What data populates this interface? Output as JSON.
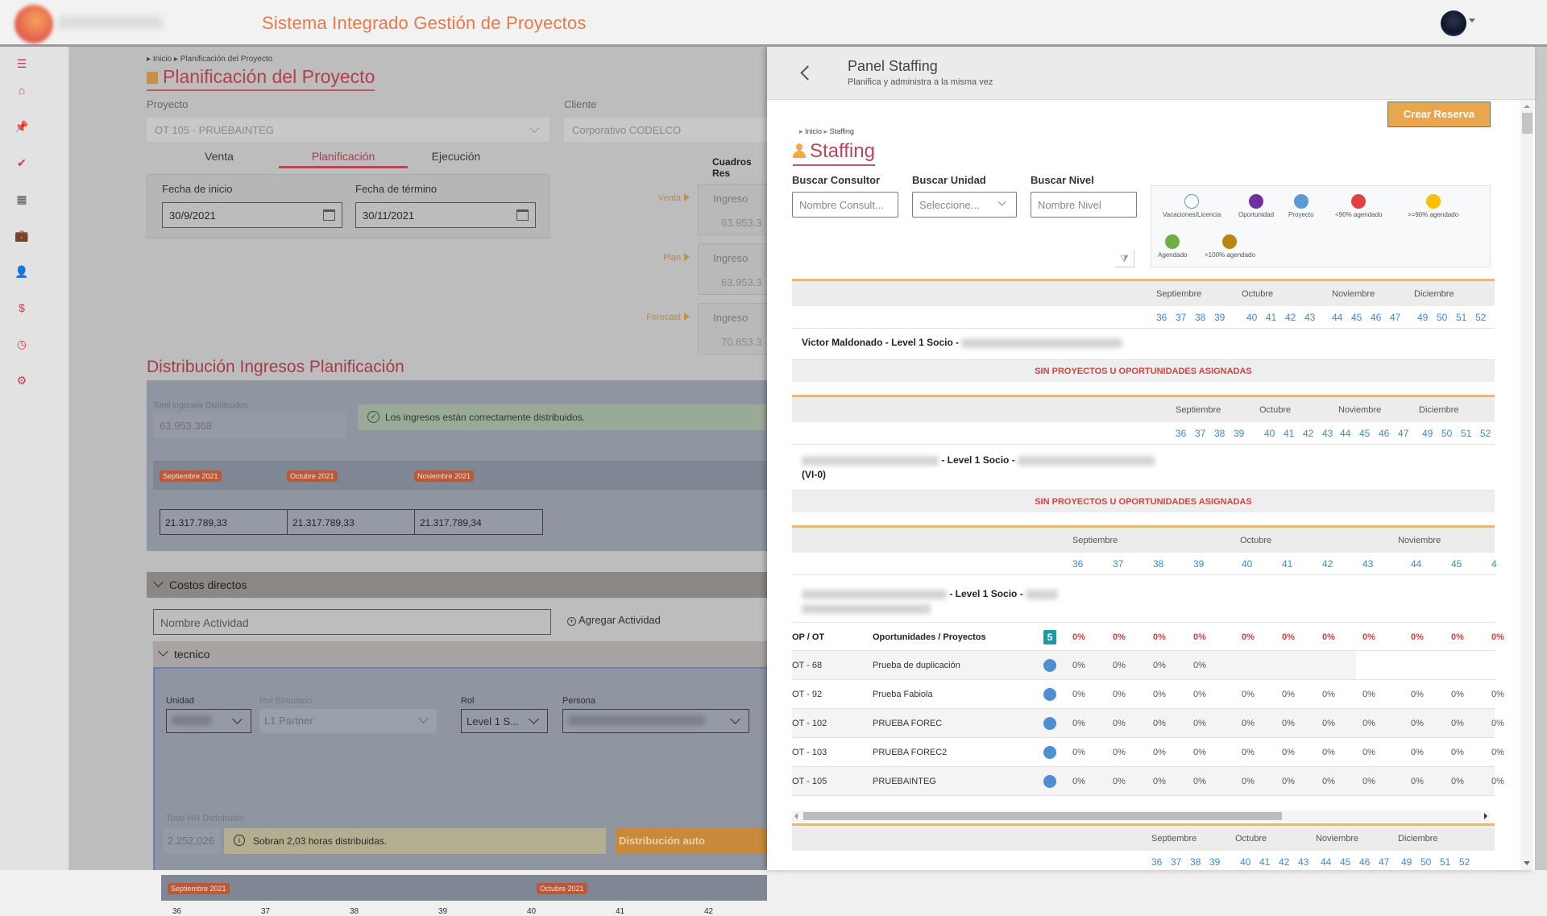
{
  "app": {
    "title": "Sistema Integrado Gestión de Proyectos"
  },
  "sidebar": {
    "items": [
      {
        "icon": "menu-icon",
        "glyph": "☰"
      },
      {
        "icon": "home-icon",
        "glyph": "⌂"
      },
      {
        "icon": "pin-icon",
        "glyph": "📌"
      },
      {
        "icon": "check-icon",
        "glyph": "✔"
      },
      {
        "icon": "calendar-icon",
        "glyph": "▦"
      },
      {
        "icon": "briefcase-icon",
        "glyph": "💼"
      },
      {
        "icon": "user-icon",
        "glyph": "👤"
      },
      {
        "icon": "dollar-icon",
        "glyph": "$"
      },
      {
        "icon": "clock-icon",
        "glyph": "◷"
      },
      {
        "icon": "gear-icon",
        "glyph": "⚙"
      }
    ]
  },
  "planning": {
    "breadcrumb": "▸ Inicio ▸ Planificación del Proyecto",
    "title": "Planificación del Proyecto",
    "proyecto_label": "Proyecto",
    "proyecto_value": "OT 105 - PRUEBAINTEG",
    "cliente_label": "Cliente",
    "cliente_value": "Corporativo CODELCO",
    "tabs": [
      "Venta",
      "Planificación",
      "Ejecución"
    ],
    "active_tab": "Planificación",
    "fecha_inicio_label": "Fecha de inicio",
    "fecha_inicio": "30/9/2021",
    "fecha_termino_label": "Fecha de término",
    "fecha_termino": "30/11/2021",
    "summary_title": "Cuadros Res",
    "summary": [
      {
        "label": "Venta",
        "title": "Ingreso",
        "value": "63.953.3"
      },
      {
        "label": "Plan",
        "title": "Ingreso",
        "value": "63.953.3"
      },
      {
        "label": "Forecast",
        "title": "Ingreso",
        "value": "70.853.3"
      }
    ],
    "dist_title": "Distribución Ingresos Planificación",
    "total_label": "Total Ingresos Distribuidos",
    "total_value": "63.953.368",
    "ok_message": "Los ingresos están correctamente distribuidos.",
    "months": [
      {
        "label": "Septiembre 2021",
        "value": "21.317.789,33"
      },
      {
        "label": "Octubre 2021",
        "value": "21.317.789,33"
      },
      {
        "label": "Noviembre 2021",
        "value": "21.317.789,34"
      }
    ],
    "costos_title": "Costos directos",
    "actividad_placeholder": "Nombre Actividad",
    "agregar_actividad": "Agregar Actividad",
    "tecnico_title": "tecnico",
    "unidad_label": "Unidad",
    "rol_simulado_label": "Rol Simulado",
    "rol_simulado_value": "L1 Partner",
    "rol_label": "Rol",
    "rol_value": "Level 1 S...",
    "persona_label": "Persona",
    "total_hh_label": "Total HH Distribuido",
    "total_hh_value": "2.252,026",
    "warn_message": "Sobran 2,03 horas distribuidas.",
    "auto_button": "Distribución auto",
    "tec_months": [
      "Septiembre 2021",
      "Octubre 2021"
    ],
    "tec_weeks": [
      "36",
      "37",
      "38",
      "39",
      "40",
      "41",
      "42"
    ]
  },
  "staffing": {
    "panel_title": "Panel Staffing",
    "panel_subtitle": "Planifica y administra a la misma vez",
    "crear_reserva": "Crear Reserva",
    "breadcrumb_home": "Inicio",
    "breadcrumb_page": "Staffing",
    "title": "Staffing",
    "filters": {
      "consultor_label": "Buscar Consultor",
      "consultor_placeholder": "Nombre Consult...",
      "unidad_label": "Buscar Unidad",
      "unidad_value": "Seleccione...",
      "nivel_label": "Buscar Nivel",
      "nivel_placeholder": "Nombre Nivel"
    },
    "legend": [
      {
        "label": "Vacaciones/Licencia",
        "color": "#ffffff",
        "border": "#5aa0a8"
      },
      {
        "label": "Oportunidad",
        "color": "#7030a0",
        "border": "#7030a0"
      },
      {
        "label": "Proyecto",
        "color": "#5b9bd5",
        "border": "#5b9bd5"
      },
      {
        "label": "<90% agendado",
        "color": "#e04040",
        "border": "#e04040"
      },
      {
        "label": ">=90% agendado",
        "color": "#ffc000",
        "border": "#ffc000"
      },
      {
        "label": "Agendado",
        "color": "#70ad47",
        "border": "#70ad47"
      },
      {
        "label": ">100% agendado",
        "color": "#b8860b",
        "border": "#b8860b"
      }
    ],
    "months": [
      "Septiembre",
      "Octubre",
      "Noviembre",
      "Diciembre"
    ],
    "weeks": [
      [
        "36",
        "37",
        "38",
        "39"
      ],
      [
        "40",
        "41",
        "42",
        "43"
      ],
      [
        "44",
        "45",
        "46",
        "47"
      ],
      [
        "49",
        "50",
        "51",
        "52"
      ]
    ],
    "no_assign": "SIN PROYECTOS U OPORTUNIDADES ASIGNADAS",
    "consultants": [
      {
        "name": "Victor Maldonado",
        "level": " - Level 1 Socio - ",
        "extra": ""
      },
      {
        "name": "",
        "level": " - Level 1 Socio - ",
        "extra": "(VI-0)"
      },
      {
        "name": "",
        "level": " - Level 1 Socio - ",
        "extra": ""
      }
    ],
    "table": {
      "col_op": "OP / OT",
      "col_name": "Oportunidades / Proyectos",
      "count": "5",
      "header_pct": [
        "0%",
        "0%",
        "0%",
        "0%",
        "0%",
        "0%",
        "0%",
        "0%",
        "0%",
        "0%",
        "0%"
      ],
      "rows": [
        {
          "op": "OT - 68",
          "name": "Prueba de duplicación",
          "values": [
            "0%",
            "0%",
            "0%",
            "0%"
          ]
        },
        {
          "op": "OT - 92",
          "name": "Prueba Fabiola",
          "values": [
            "0%",
            "0%",
            "0%",
            "0%",
            "0%",
            "0%",
            "0%",
            "0%",
            "0%",
            "0%",
            "0%"
          ]
        },
        {
          "op": "OT - 102",
          "name": "PRUEBA FOREC",
          "values": [
            "0%",
            "0%",
            "0%",
            "0%",
            "0%",
            "0%",
            "0%",
            "0%",
            "0%",
            "0%",
            "0%"
          ]
        },
        {
          "op": "OT - 103",
          "name": "PRUEBA FOREC2",
          "values": [
            "0%",
            "0%",
            "0%",
            "0%",
            "0%",
            "0%",
            "0%",
            "0%",
            "0%",
            "0%",
            "0%"
          ]
        },
        {
          "op": "OT - 105",
          "name": "PRUEBAINTEG",
          "values": [
            "0%",
            "0%",
            "0%",
            "0%",
            "0%",
            "0%",
            "0%",
            "0%",
            "0%",
            "0%",
            "0%"
          ]
        }
      ],
      "months": [
        "Septiembre",
        "Octubre",
        "Noviembre"
      ],
      "weeks": [
        "36",
        "37",
        "38",
        "39",
        "40",
        "41",
        "42",
        "43",
        "44",
        "45",
        "4"
      ]
    }
  }
}
